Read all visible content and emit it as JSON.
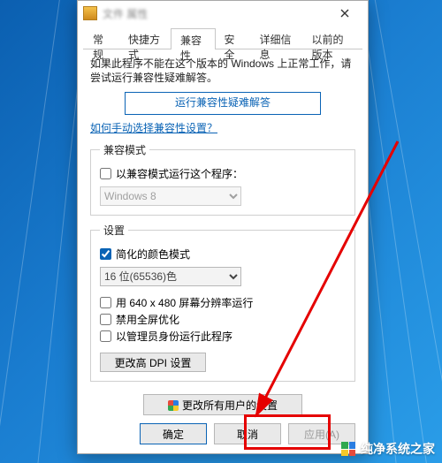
{
  "window": {
    "title": "文件 属性"
  },
  "tabs": {
    "general": "常规",
    "shortcut": "快捷方式",
    "compat": "兼容性",
    "security": "安全",
    "details": "详细信息",
    "previous": "以前的版本",
    "active": "compat"
  },
  "compat": {
    "intro": "如果此程序不能在这个版本的 Windows 上正常工作，请尝试运行兼容性疑难解答。",
    "troubleshoot_btn": "运行兼容性疑难解答",
    "help_link": "如何手动选择兼容性设置？",
    "mode_group": "兼容模式",
    "mode_checkbox": "以兼容模式运行这个程序：",
    "mode_checked": false,
    "mode_select": "Windows 8",
    "settings_group": "设置",
    "reduced_color": "简化的颜色模式",
    "reduced_color_checked": true,
    "color_select": "16 位(65536)色",
    "res_640": "用 640 x 480 屏幕分辨率运行",
    "res_640_checked": false,
    "disable_fullscreen": "禁用全屏优化",
    "disable_fullscreen_checked": false,
    "run_admin": "以管理员身份运行此程序",
    "run_admin_checked": false,
    "dpi_btn": "更改高 DPI 设置",
    "all_users_btn": "更改所有用户的设置"
  },
  "buttons": {
    "ok": "确定",
    "cancel": "取消",
    "apply": "应用(A)"
  },
  "watermark": "纯净系统之家"
}
